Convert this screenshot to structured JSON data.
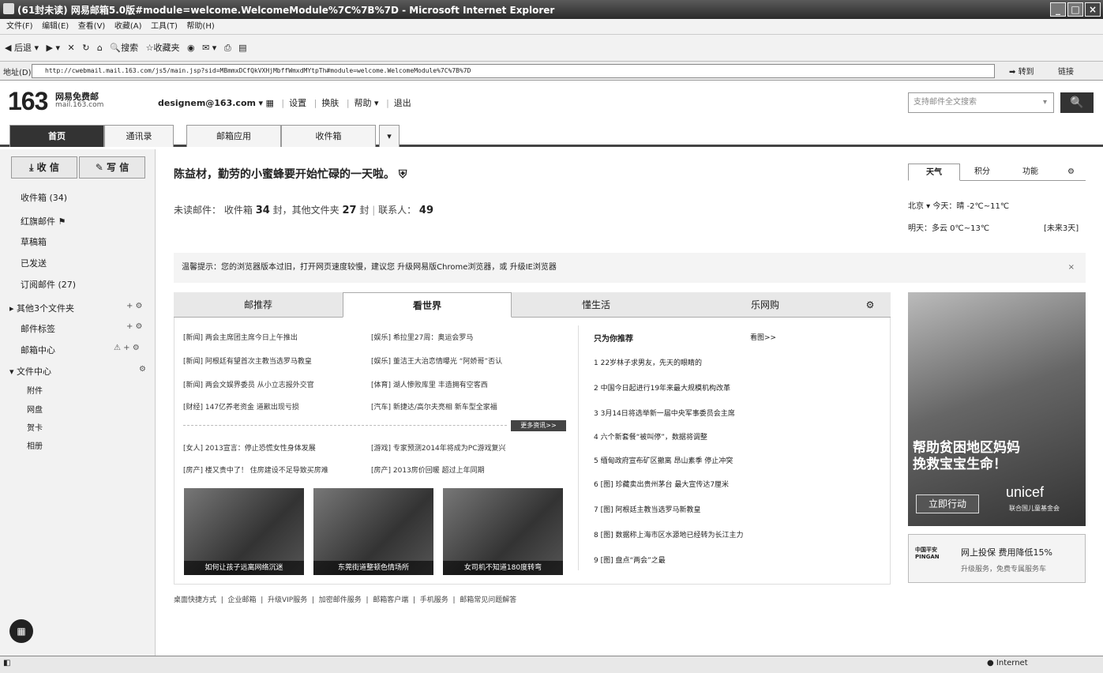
{
  "window": {
    "title": "(61封未读) 网易邮箱5.0版#module=welcome.WelcomeModule%7C%7B%7D - Microsoft Internet Explorer",
    "minimize": "_",
    "maximize": "□",
    "close": "×"
  },
  "menu": [
    "文件(F)",
    "编辑(E)",
    "查看(V)",
    "收藏(A)",
    "工具(T)",
    "帮助(H)"
  ],
  "toolbar": {
    "back": "后退",
    "search": "搜索",
    "favorites": "收藏夹"
  },
  "address": {
    "label": "地址(D)",
    "url": "http://cwebmail.mail.163.com/js5/main.jsp?sid=MBmmxDCfQkVXHjMbffWmxdMYtpTh#module=welcome.WelcomeModule%7C%7B%7D",
    "go": "转到",
    "links": "链接"
  },
  "header": {
    "logo": "163",
    "logo_name": "网易免费邮",
    "logo_domain": "mail.163.com",
    "user": "designem@163.com",
    "links": [
      "设置",
      "换肤",
      "帮助",
      "退出"
    ],
    "search_placeholder": "支持邮件全文搜索"
  },
  "nav": {
    "tabs": [
      "首页",
      "通讯录",
      "邮箱应用",
      "收件箱"
    ]
  },
  "sidebar": {
    "receive": "收 信",
    "compose": "写 信",
    "folders": [
      "收件箱 (34)",
      "红旗邮件",
      "草稿箱",
      "已发送",
      "订阅邮件 (27)",
      "其他3个文件夹",
      "邮件标签",
      "邮箱中心",
      "文件中心"
    ],
    "subfolders": [
      "附件",
      "网盘",
      "贺卡",
      "相册"
    ]
  },
  "main": {
    "greeting": "陈益材，勤劳的小蜜蜂要开始忙碌的一天啦。",
    "unread_label": "未读邮件：",
    "inbox_label": "收件箱",
    "inbox_count": "34",
    "other_label": "封，其他文件夹",
    "other_count": "27",
    "unit": "封",
    "contacts_label": "联系人：",
    "contacts_count": "49",
    "notice": "温馨提示：您的浏览器版本过旧，打开网页速度较慢，建议您 升级网易版Chrome浏览器，或 升级IE浏览器",
    "notice_close": "×"
  },
  "weather": {
    "tabs": [
      "天气",
      "积分",
      "功能"
    ],
    "city": "北京 ▾ 今天：晴 -2℃~11℃",
    "tomorrow": "明天：多云 0℃~13℃",
    "future": "[未来3天]"
  },
  "news": {
    "tabs": [
      "邮推荐",
      "看世界",
      "懂生活",
      "乐网购"
    ],
    "left_col": [
      "[新闻] 两会主席团主席今日上午推出",
      "[新闻] 阿根廷有望首次主教当选罗马教皇",
      "[新闻] 两会文娱界委员 从小立志报外交官",
      "[财经] 147亿养老资金 道歉出现亏损"
    ],
    "right_col": [
      "[娱乐] 希拉里27周：奥运会罗马",
      "[娱乐] 董洁王大治恋情曝光 “阿娇哥”否认",
      "[体育] 湖人惨败库里 丰造拥有空客西",
      "[汽车] 新捷达/高尔夫亮相 新车型全家福"
    ],
    "more": "更多资讯>>",
    "left_col2": [
      "[女人] 2013宣言：停止恐慌女性身体发展",
      "[房产] 楼又贵中了！ 住房建设不足导致买房难"
    ],
    "right_col2": [
      "[游戏] 专家预测2014年将成为PC游戏复兴",
      "[房产] 2013房价回暖 超过上年同期"
    ],
    "photos": [
      "如何让孩子远离网络沉迷",
      "东莞街道整顿色情场所",
      "女司机不知道180度转弯"
    ],
    "rec_title": "只为你推荐",
    "rec_more": "看图>>",
    "recs": [
      "1 22岁林子求男友，先天的眼睛的",
      "2 中国今日起进行19年来最大规模机构改革",
      "3 3月14日将选举新一届中央军事委员会主席",
      "4 六个新套餐“被叫停”，数据将调整",
      "5 缅甸政府宣布矿区撤离 昂山素季 停止冲突",
      "6 [图] 珍藏卖出贵州茅台 最大宣传达7厘米",
      "7 [图] 阿根廷主教当选罗马新教皇",
      "8 [图] 数据称上海市区水源地已经转为长江主力",
      "9 [图] 盘点“两会”之最"
    ]
  },
  "ads": {
    "line1": "帮助贫困地区妈妈",
    "line2": "挽救宝宝生命！",
    "action": "立即行动",
    "brand": "unicef",
    "brand_sub": "联合国儿童基金会",
    "insurance_logo": "中国平安 PINGAN",
    "insurance_text": "网上投保 费用降低15%",
    "insurance_sub": "升级服务，免费专属服务车"
  },
  "footer": [
    "桌面快捷方式",
    "企业邮箱",
    "升级VIP服务",
    "加密邮件服务",
    "邮箱客户端",
    "手机服务",
    "邮箱常见问题解答"
  ],
  "status": {
    "zone": "Internet"
  }
}
